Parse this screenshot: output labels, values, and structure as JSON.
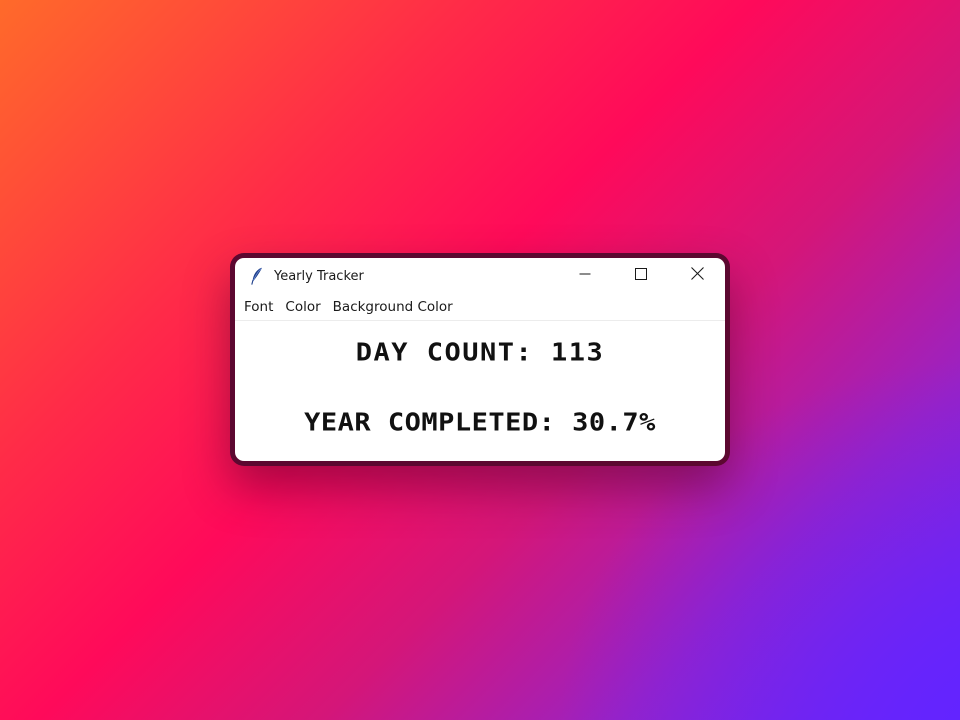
{
  "window": {
    "title": "Yearly Tracker",
    "app_icon": "feather-icon",
    "controls": [
      "minimize-icon",
      "maximize-icon",
      "close-icon"
    ]
  },
  "menubar": {
    "items": [
      {
        "label": "Font"
      },
      {
        "label": "Color"
      },
      {
        "label": "Background Color"
      }
    ]
  },
  "content": {
    "day_count": "DAY COUNT: 113",
    "year_completed": "YEAR COMPLETED: 30.7%"
  },
  "colors": {
    "window_border": "#5c0830",
    "text": "#111111",
    "background": "#ffffff"
  }
}
